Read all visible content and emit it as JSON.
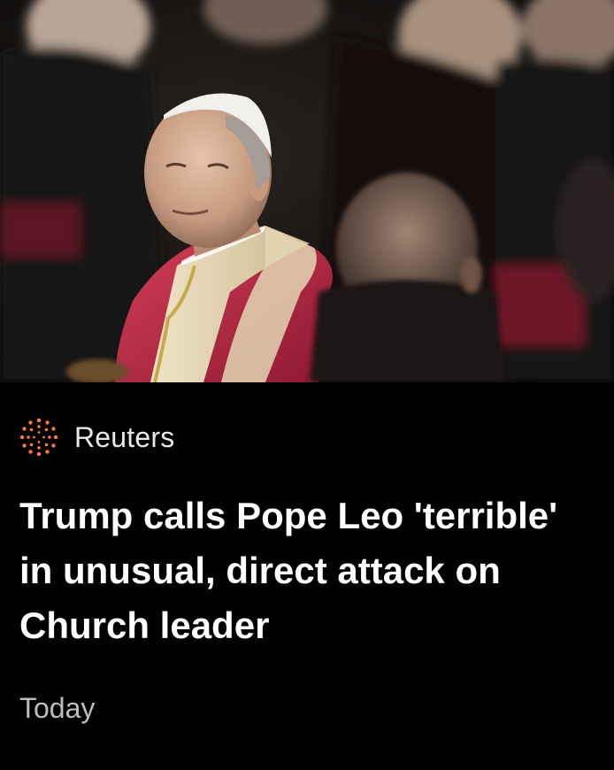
{
  "article": {
    "image_icon": "news-photo",
    "source": {
      "icon": "reuters-logo-icon",
      "name": "Reuters",
      "accent_color": "#ff7a3d"
    },
    "headline": "Trump calls Pope Leo 'terrible' in unusual, direct attack on Church leader",
    "date": "Today"
  },
  "colors": {
    "background": "#000000",
    "headline": "#ffffff",
    "source_text": "#e9e9e9",
    "date_text": "#bdbdbd"
  }
}
